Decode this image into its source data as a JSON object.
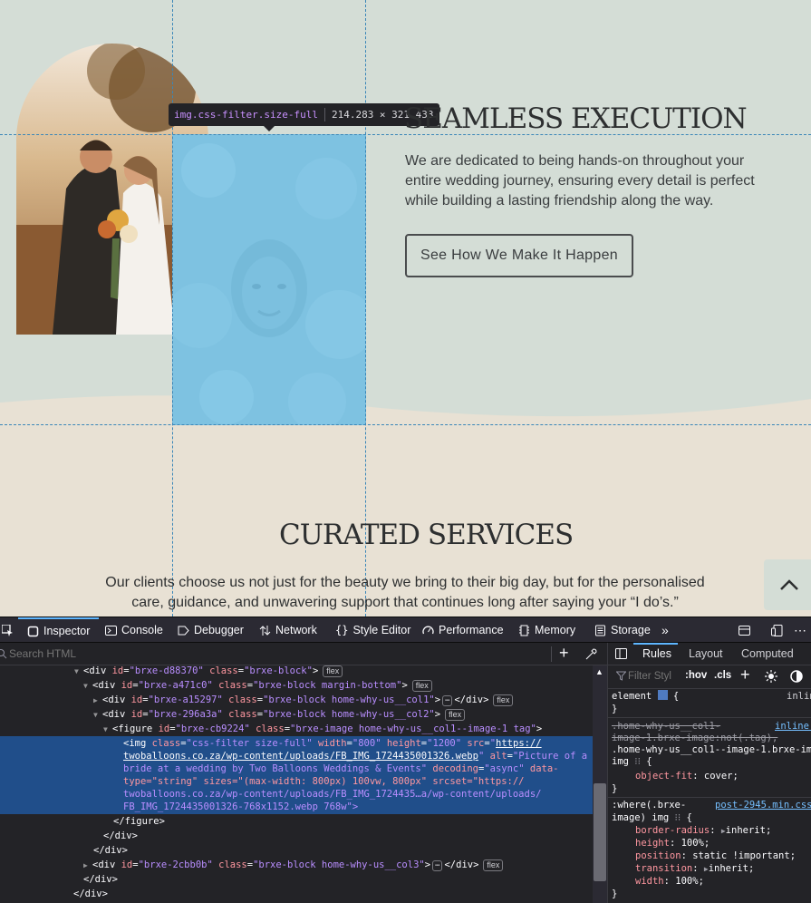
{
  "tooltip": {
    "name": "img.css-filter.size-full",
    "dims": "214.283 × 321.433"
  },
  "exec": {
    "heading": "SEAMLESS EXECUTION",
    "body": "We are dedicated to being hands-on throughout your entire wedding journey, ensuring every detail is perfect while building a lasting friendship along the way.",
    "button": "See How We Make It Happen"
  },
  "services": {
    "heading": "CURATED SERVICES",
    "body": "Our clients choose us not just for the beauty we bring to their big day, but for the personalised care, guidance, and unwavering support that continues long after saying your “I do’s.”"
  },
  "devtools": {
    "tabs": [
      "Inspector",
      "Console",
      "Debugger",
      "Network",
      "Style Editor",
      "Performance",
      "Memory",
      "Storage"
    ],
    "search_placeholder": "Search HTML",
    "side_tabs": [
      "Rules",
      "Layout",
      "Computed"
    ],
    "filter_placeholder": "Filter Styl",
    "hov": ":hov",
    "cls": ".cls",
    "flex_badge": "flex",
    "html": {
      "l1": {
        "id": "brxe-d88370",
        "cls": "brxe-block"
      },
      "l2": {
        "id": "brxe-a471c0",
        "cls": "brxe-block margin-bottom"
      },
      "l3": {
        "id": "brxe-a15297",
        "cls": "brxe-block home-why-us__col1"
      },
      "l4": {
        "id": "brxe-296a3a",
        "cls": "brxe-block home-why-us__col2"
      },
      "l5": {
        "id": "brxe-cb9224",
        "cls": "brxe-image home-why-us__col1--image-1 tag"
      },
      "img": {
        "cls": "css-filter size-full",
        "width": "800",
        "height": "1200",
        "src1": "https://",
        "src2": "twoballoons.co.za/wp-content/uploads/FB_IMG_1724435001326.webp",
        "alt1": "Picture of a",
        "alt2": "bride at a wedding by Two Balloons Weddings & Events",
        "decoding": "async",
        "data1": "data-",
        "data2": "type=\"string\" sizes=\"(max-width: 800px) 100vw, 800px\" srcset=\"https://",
        "srcset1": "twoballoons.co.za/wp-content/uploads/FB_IMG_1724435…a/wp-content/uploads/",
        "srcset2": "FB_IMG_1724435001326-768x1152.webp 768w\">"
      },
      "close_figure": "</figure>",
      "close_div": "</div>",
      "l6": {
        "id": "brxe-2cbb0b",
        "cls": "brxe-block home-why-us__col3"
      }
    },
    "rules": {
      "element_sel": "element",
      "element_src": "inlin",
      "r2_sel1": ".home-why-us__col1-",
      "r2_sel2": "image-1.brxe-image:not(.tag),",
      "r2_sel3": ".home-why-us__col1--image-1.brxe-image",
      "r2_sel4": "img",
      "r2_src": "inline:",
      "r2_prop": "object-fit",
      "r2_val": "cover",
      "r3_sel1": ":where(.brxe-",
      "r3_sel2": "image) img",
      "r3_src": "post-2945.min.css:",
      "p1": "border-radius",
      "v1": "inherit",
      "p2": "height",
      "v2": "100%",
      "p3": "position",
      "v3": "static !important",
      "p4": "transition",
      "v4": "inherit",
      "p5": "width",
      "v5": "100%"
    }
  }
}
